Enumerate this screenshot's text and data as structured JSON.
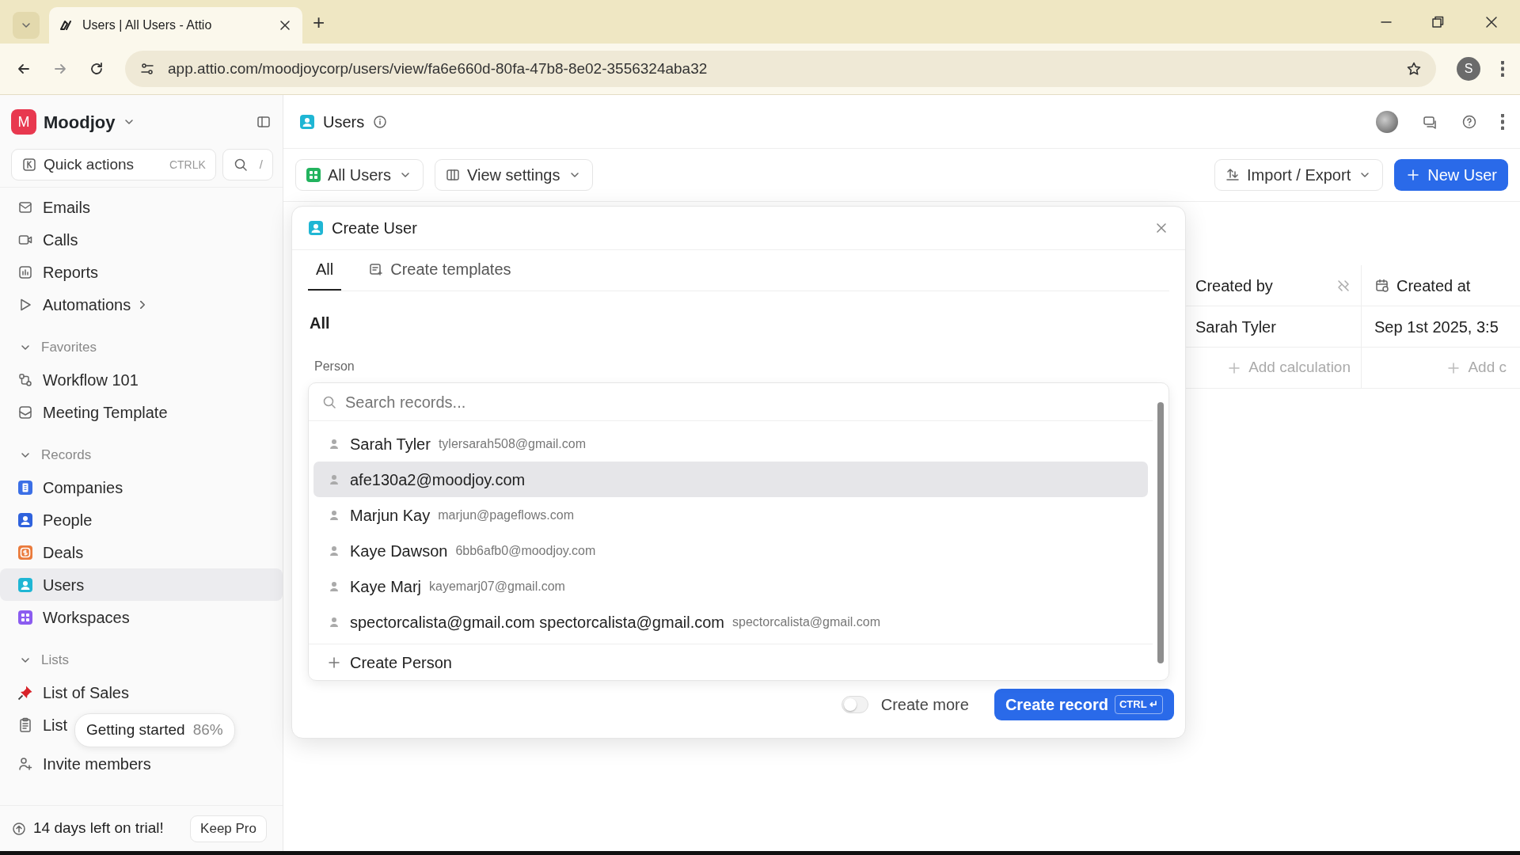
{
  "browser": {
    "tab_title": "Users | All Users - Attio",
    "new_tab": "+",
    "url": "app.attio.com/moodjoycorp/users/view/fa6e660d-80fa-47b8-8e02-3556324aba32",
    "profile_initial": "S"
  },
  "sidebar": {
    "workspace": {
      "initial": "M",
      "name": "Moodjoy"
    },
    "quick_actions": {
      "label": "Quick actions",
      "shortcut": "CTRLK"
    },
    "search_shortcut": "/",
    "nav": [
      {
        "label": "Emails",
        "selected": false,
        "has_submenu": false
      },
      {
        "label": "Calls",
        "selected": false,
        "has_submenu": false
      },
      {
        "label": "Reports",
        "selected": false,
        "has_submenu": false
      },
      {
        "label": "Automations",
        "selected": false,
        "has_submenu": true
      }
    ],
    "sections": [
      {
        "title": "Favorites",
        "expanded": true,
        "items": [
          {
            "label": "Workflow 101",
            "selected": false
          },
          {
            "label": "Meeting Template",
            "selected": false
          }
        ]
      },
      {
        "title": "Records",
        "expanded": true,
        "items": [
          {
            "label": "Companies",
            "color": "#3b6fe6",
            "selected": false
          },
          {
            "label": "People",
            "color": "#2f62dd",
            "selected": false
          },
          {
            "label": "Deals",
            "color": "#ea7a3b",
            "selected": false
          },
          {
            "label": "Users",
            "color": "#1fb6d4",
            "selected": true
          },
          {
            "label": "Workspaces",
            "color": "#8b5cf0",
            "selected": false
          }
        ]
      },
      {
        "title": "Lists",
        "expanded": true,
        "items": [
          {
            "label": "List of Sales",
            "selected": false
          },
          {
            "label": "List",
            "selected": false
          }
        ]
      }
    ],
    "getting_started": {
      "label": "Getting started",
      "percent": "86%"
    },
    "invite": "Invite members",
    "trial": {
      "text": "14 days left on trial!",
      "button": "Keep Pro"
    }
  },
  "header": {
    "title": "Users",
    "views": "All Users",
    "view_settings": "View settings",
    "import_export": "Import / Export",
    "new_button": "New User"
  },
  "table": {
    "columns": [
      "Created by",
      "Created at"
    ],
    "rows": [
      [
        "Sarah Tyler",
        "Sep 1st 2025, 3:5"
      ]
    ],
    "calculations": [
      "Add calculation",
      "Add c"
    ]
  },
  "modal": {
    "title": "Create User",
    "tabs": [
      {
        "label": "All",
        "selected": true
      },
      {
        "label": "Create templates",
        "selected": false
      }
    ],
    "section": "All",
    "field_label": "Person",
    "search_placeholder": "Search records...",
    "options": [
      {
        "name": "Sarah Tyler",
        "email": "tylersarah508@gmail.com",
        "hovered": false
      },
      {
        "name": "afe130a2@moodjoy.com",
        "hovered": true
      },
      {
        "name": "Marjun Kay",
        "email": "marjun@pageflows.com",
        "hovered": false
      },
      {
        "name": "Kaye Dawson",
        "email": "6bb6afb0@moodjoy.com",
        "hovered": false
      },
      {
        "name": "Kaye Marj",
        "email": "kayemarj07@gmail.com",
        "hovered": false
      },
      {
        "name": "spectorcalista@gmail.com spectorcalista@gmail.com",
        "email": "spectorcalista@gmail.com",
        "hovered": false
      }
    ],
    "create_option": "Create Person",
    "create_more": {
      "label": "Create more",
      "on": false
    },
    "submit": {
      "label": "Create record",
      "shortcut": "CTRL ↵"
    }
  }
}
